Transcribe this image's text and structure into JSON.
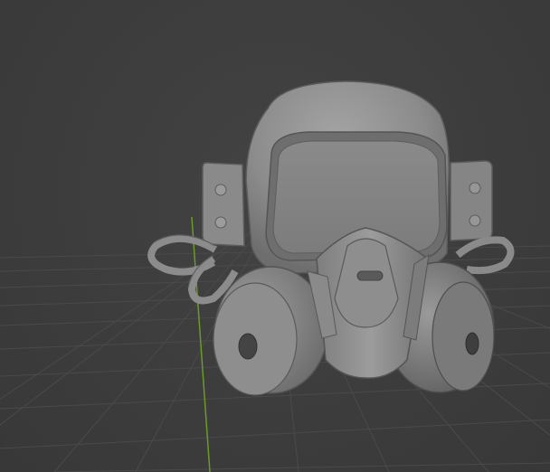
{
  "viewport": {
    "name": "3D Viewport",
    "shading": "solid",
    "background_color": "#3d3d3d",
    "grid_color": "#4a4a4a",
    "y_axis_color": "#6a9a2a"
  },
  "scene": {
    "object_type": "3D model",
    "object_description_icon": "gas-mask-model",
    "material_color": "#8a8a8a"
  }
}
